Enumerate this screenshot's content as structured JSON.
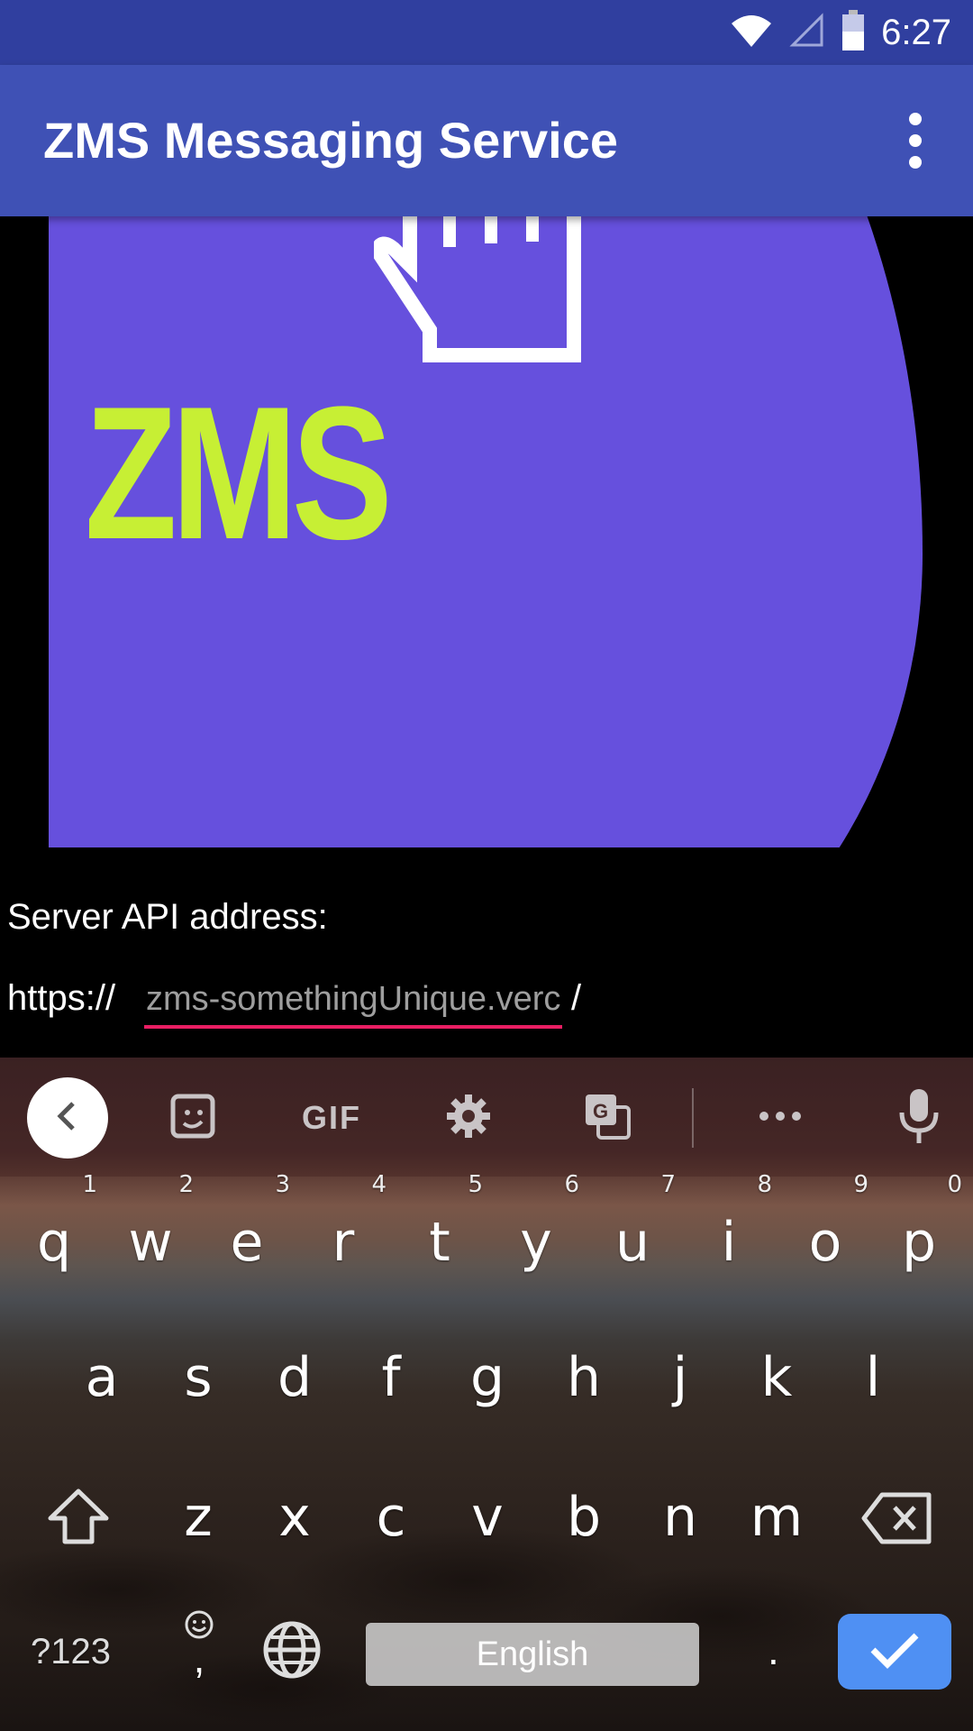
{
  "status_bar": {
    "time": "6:27",
    "icons": [
      "wifi-icon",
      "cell-signal-icon",
      "battery-icon"
    ]
  },
  "app_bar": {
    "title": "ZMS Messaging Service",
    "menu_icon": "overflow-menu-icon"
  },
  "logo": {
    "text": "ZMS",
    "icon": "hand-pointer-icon",
    "colors": {
      "background": "#6650dd",
      "text": "#c7ef34"
    }
  },
  "form": {
    "server_label": "Server API address:",
    "url_prefix": "https://",
    "url_placeholder": "zms-somethingUnique.vercel.app",
    "url_suffix": "/",
    "accent_color": "#e91e63"
  },
  "keyboard": {
    "toolbar": {
      "back_icon": "chevron-left-icon",
      "sticker_icon": "sticker-icon",
      "gif_label": "GIF",
      "settings_icon": "gear-icon",
      "translate_icon": "translate-icon",
      "more_icon": "more-horizontal-icon",
      "mic_icon": "microphone-icon"
    },
    "row1": [
      {
        "key": "q",
        "hint": "1"
      },
      {
        "key": "w",
        "hint": "2"
      },
      {
        "key": "e",
        "hint": "3"
      },
      {
        "key": "r",
        "hint": "4"
      },
      {
        "key": "t",
        "hint": "5"
      },
      {
        "key": "y",
        "hint": "6"
      },
      {
        "key": "u",
        "hint": "7"
      },
      {
        "key": "i",
        "hint": "8"
      },
      {
        "key": "o",
        "hint": "9"
      },
      {
        "key": "p",
        "hint": "0"
      }
    ],
    "row2": [
      "a",
      "s",
      "d",
      "f",
      "g",
      "h",
      "j",
      "k",
      "l"
    ],
    "row3": [
      "z",
      "x",
      "c",
      "v",
      "b",
      "n",
      "m"
    ],
    "symbols_label": "?123",
    "comma_label": ",",
    "space_label": "English",
    "period_label": ".",
    "enter_color": "#4f90f3"
  }
}
